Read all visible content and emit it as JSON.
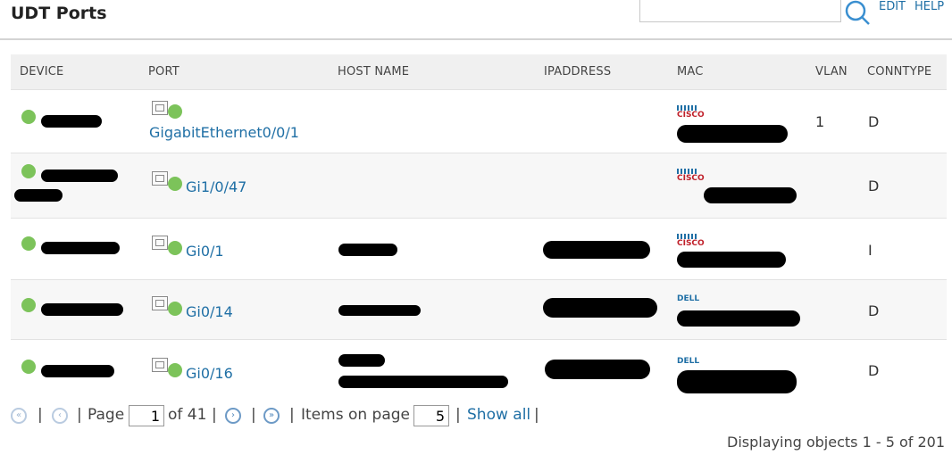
{
  "header": {
    "title": "UDT Ports",
    "search_value": "",
    "edit_label": "EDIT",
    "help_label": "HELP"
  },
  "columns": [
    "DEVICE",
    "PORT",
    "HOST NAME",
    "IPADDRESS",
    "MAC",
    "VLAN",
    "CONNTYPE"
  ],
  "rows": [
    {
      "device_status": "up",
      "port": "GigabitEthernet0/0/1",
      "port_status": "up",
      "mac_vendor": "CISCO",
      "vlan": "1",
      "conntype": "D"
    },
    {
      "device_status": "up",
      "port": "Gi1/0/47",
      "port_status": "up",
      "mac_vendor": "CISCO",
      "vlan": "",
      "conntype": "D"
    },
    {
      "device_status": "up",
      "port": "Gi0/1",
      "port_status": "up",
      "mac_vendor": "CISCO",
      "vlan": "",
      "conntype": "I"
    },
    {
      "device_status": "up",
      "port": "Gi0/14",
      "port_status": "up",
      "mac_vendor": "DELL",
      "vlan": "",
      "conntype": "D"
    },
    {
      "device_status": "up",
      "port": "Gi0/16",
      "port_status": "up",
      "mac_vendor": "DELL",
      "vlan": "",
      "conntype": "D"
    }
  ],
  "pager": {
    "sep": "|",
    "page_label": "Page",
    "page_value": "1",
    "of_label": "of 41",
    "items_label": "Items on page",
    "items_value": "5",
    "show_all": "Show all"
  },
  "status_text": "Displaying objects 1 - 5 of 201",
  "colors": {
    "link": "#1f6fa5",
    "status_up": "#7cc35a",
    "header_bg": "#f0f0f0"
  },
  "icons": {
    "search": "search-icon",
    "port": "port-icon",
    "first": "first-page-icon",
    "prev": "prev-page-icon",
    "next": "next-page-icon",
    "last": "last-page-icon"
  }
}
